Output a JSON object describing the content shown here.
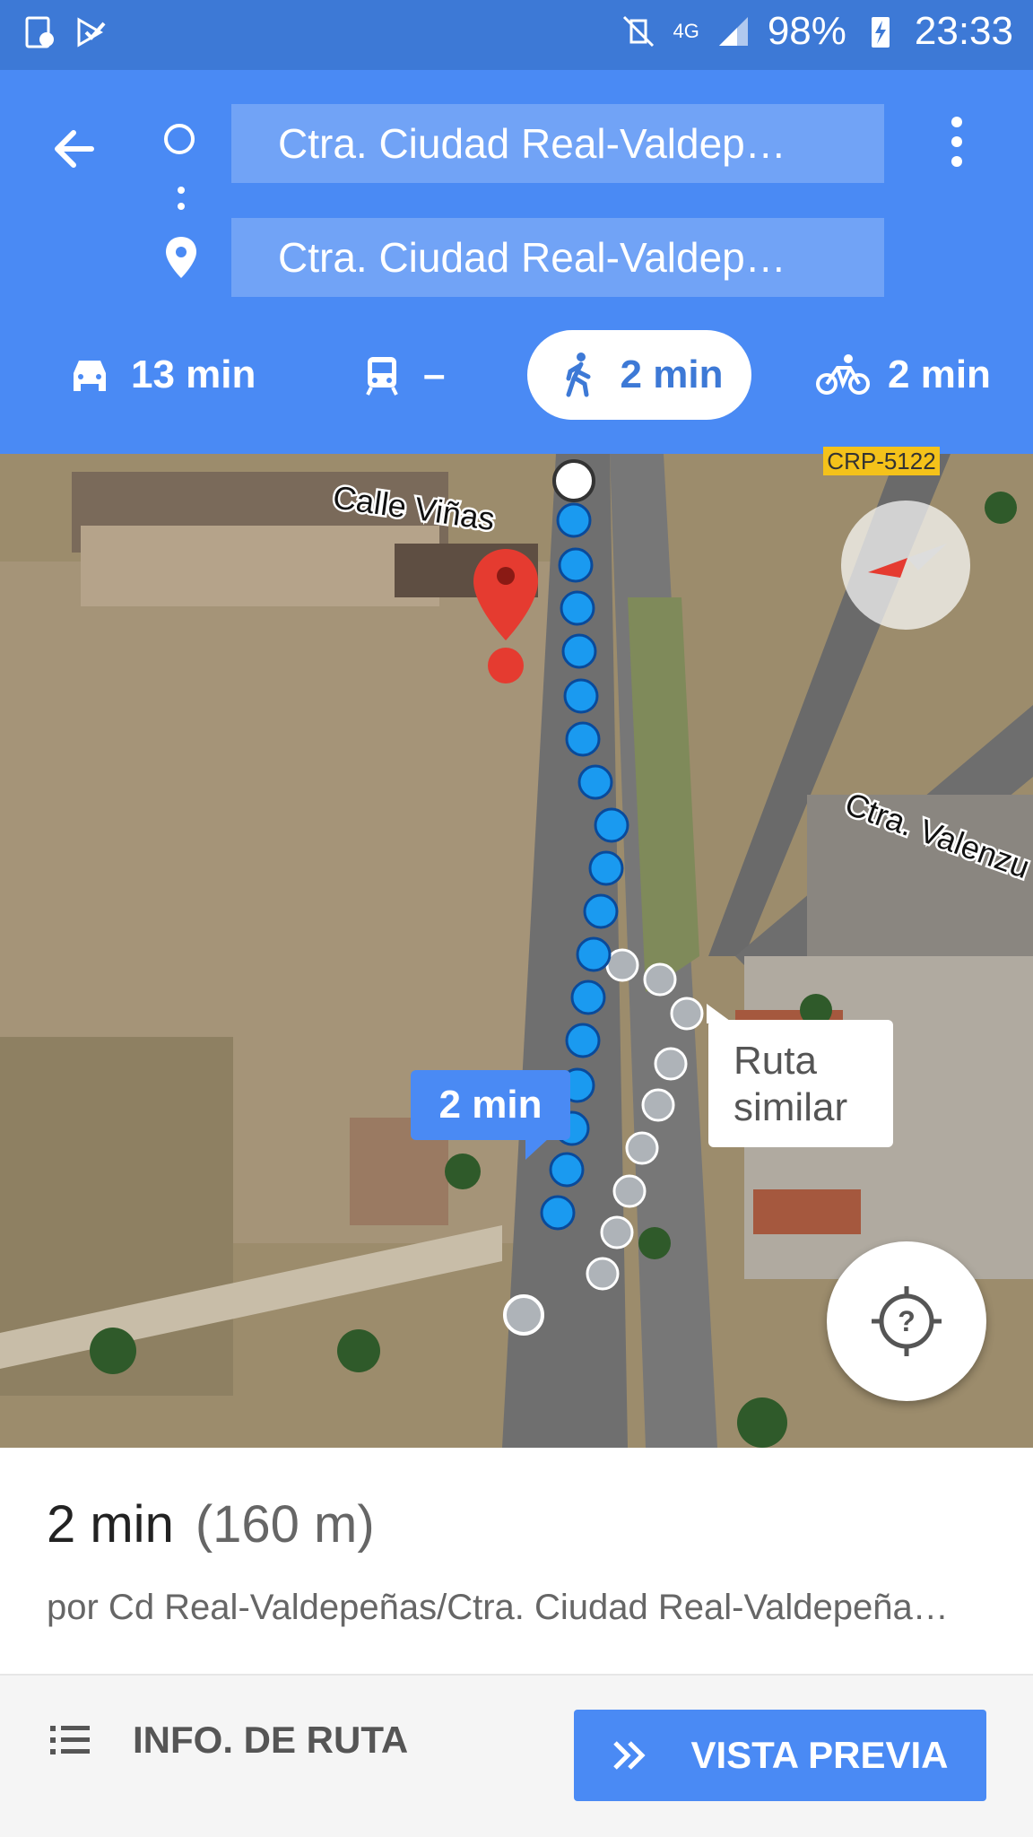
{
  "status_bar": {
    "battery": "98%",
    "time": "23:33",
    "network": "4G"
  },
  "header": {
    "origin": "Ctra. Ciudad Real-Valdep…",
    "destination": "Ctra. Ciudad Real-Valdep…",
    "modes": {
      "car": "13 min",
      "transit": "–",
      "walk": "2 min",
      "bike": "2 min"
    }
  },
  "map": {
    "street_label_1": "Calle Viñas",
    "street_label_2": "Ctra. Valenzu",
    "road_sign": "CRP-5122",
    "route_time_label": "2 min",
    "alt_route_label_line1": "Ruta",
    "alt_route_label_line2": "similar"
  },
  "summary": {
    "duration": "2 min",
    "distance": "(160 m)",
    "via": "por Cd Real-Valdepeñas/Ctra. Ciudad Real-Valdepeña…"
  },
  "bottom_bar": {
    "info_label": "INFO. DE RUTA",
    "preview_label": "VISTA PREVIA"
  },
  "colors": {
    "header": "#4a8af4",
    "status": "#3d79d6",
    "route": "#1a9af0",
    "pin": "#e53b30"
  }
}
